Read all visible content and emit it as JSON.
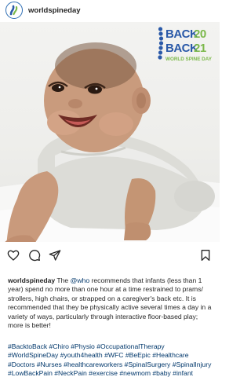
{
  "post": {
    "username": "worldspineday",
    "badge": {
      "line1_word": "BACK",
      "line1_year": "20",
      "line2_word": "BACK",
      "line2_year": "21",
      "subtitle": "WORLD SPINE DAY"
    },
    "caption": {
      "username": "worldspineday",
      "pre": "The",
      "mention": "@who",
      "text": "recommends that infants (less than 1 year) spend no more than one hour at a time restrained to prams/ strollers, high chairs, or strapped on a caregiver's back etc. It is recommended that they be physically active several times a day in a variety of ways, particularly through interactive floor-based play; more is better!"
    },
    "hashtags": "#BacktoBack #Chiro #Physio #OccupationalTherapy #WorldSpineDay #youth4health  #WFC #BeEpic #Healthcare #Doctors #Nurses #healthcareworkers #SpinalSurgery #SpinalInjury #LowBackPain #NeckPain #exercise #newmom #baby #infant #pediatrician"
  },
  "icons": {
    "avatar": "world-spine-day-logo",
    "like": "heart-icon",
    "comment": "comment-icon",
    "share": "send-icon",
    "save": "bookmark-icon"
  },
  "colors": {
    "brand_blue": "#2a59a8",
    "brand_green": "#7bb84a",
    "link": "#00376b",
    "text": "#262626"
  }
}
